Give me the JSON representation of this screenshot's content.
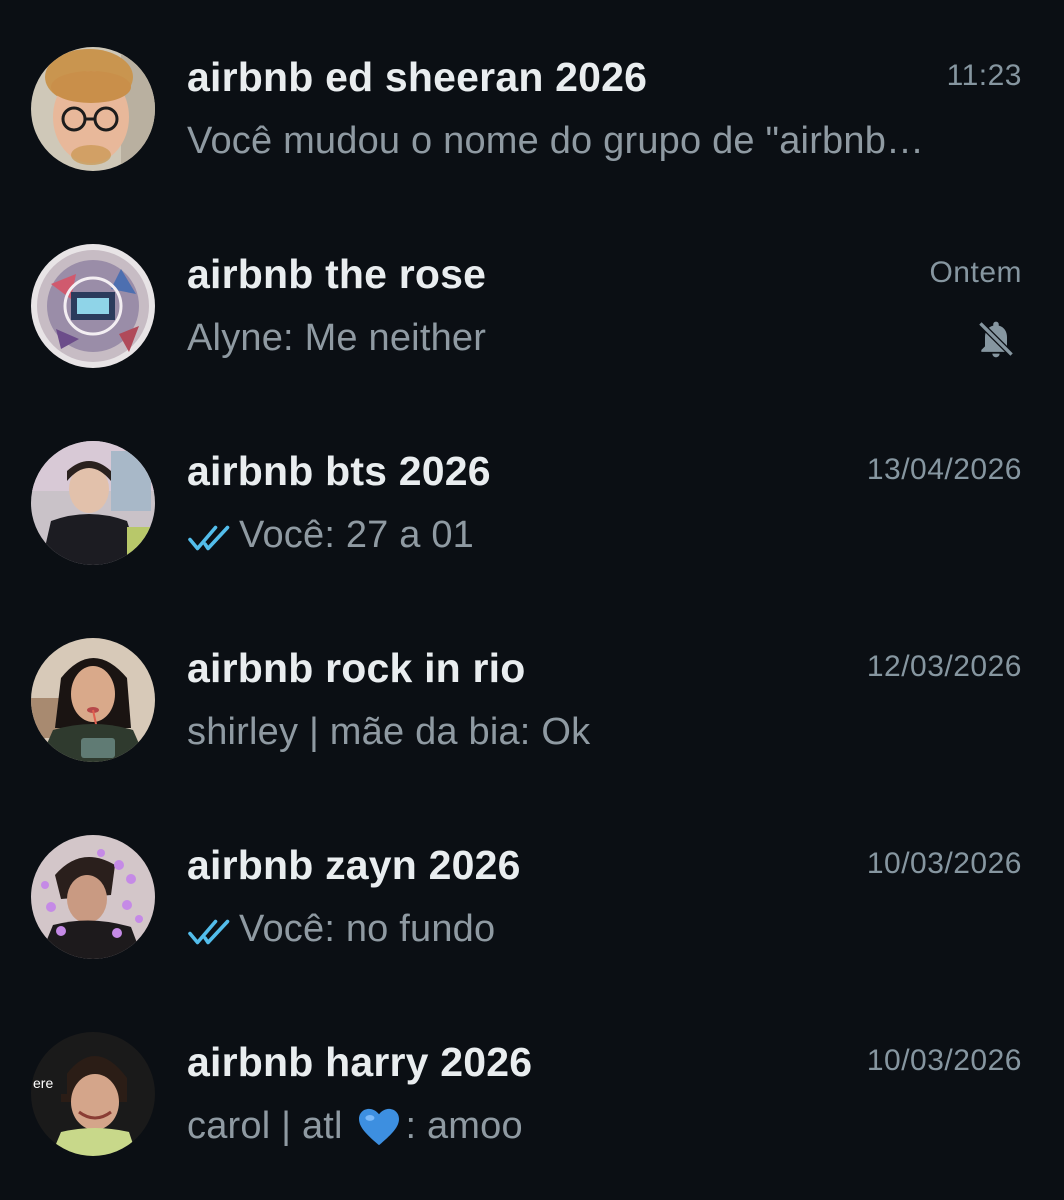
{
  "chats": [
    {
      "title": "airbnb ed sheeran 2026",
      "time": "11:23",
      "preview": "Você mudou o nome do grupo de \"airbnb…",
      "sent_by_me": false,
      "muted": false,
      "avatar_icon": "ed-sheeran-photo"
    },
    {
      "title": "airbnb the rose",
      "time": "Ontem",
      "preview": "Alyne: Me neither",
      "sent_by_me": false,
      "muted": true,
      "avatar_icon": "the-rose-artwork"
    },
    {
      "title": "airbnb bts 2026",
      "time": "13/04/2026",
      "preview": "Você: 27 a 01",
      "sent_by_me": true,
      "muted": false,
      "avatar_icon": "bts-member-photo"
    },
    {
      "title": "airbnb rock in rio",
      "time": "12/03/2026",
      "preview": "shirley | mãe da bia: Ok",
      "sent_by_me": false,
      "muted": false,
      "avatar_icon": "woman-with-straw-photo"
    },
    {
      "title": "airbnb zayn 2026",
      "time": "10/03/2026",
      "preview": "Você: no fundo",
      "sent_by_me": true,
      "muted": false,
      "avatar_icon": "zayn-hearts-photo"
    },
    {
      "title": "airbnb harry 2026",
      "time": "10/03/2026",
      "preview_before": "carol | atl ",
      "preview_emoji": "blue-heart",
      "preview_after": ": amoo",
      "sent_by_me": false,
      "muted": false,
      "avatar_icon": "harry-styles-photo",
      "avatar_text": "ere"
    }
  ],
  "colors": {
    "background": "#0b0f14",
    "title": "#e9edef",
    "secondary": "#8696a0",
    "read_ticks": "#53bdeb",
    "blue_heart": "#3d8fe0"
  }
}
